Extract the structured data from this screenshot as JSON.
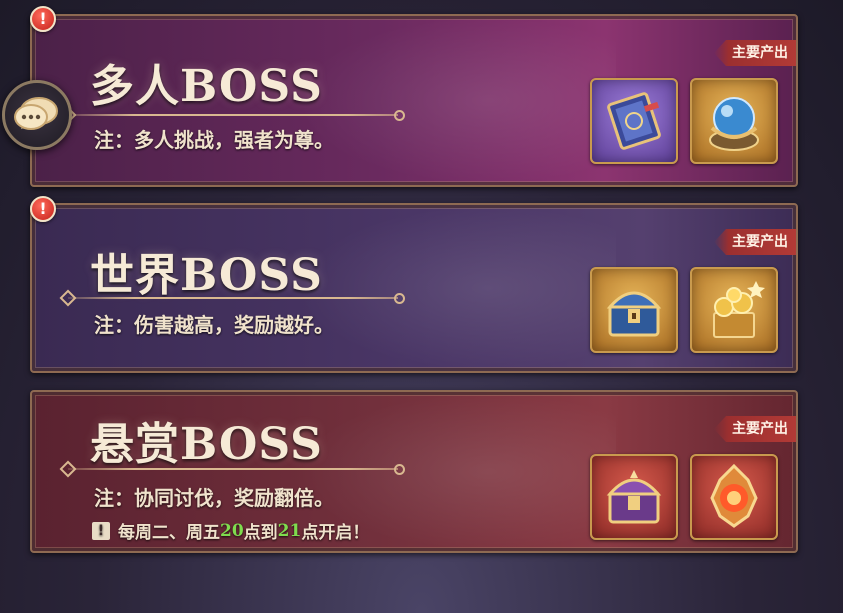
{
  "panels": [
    {
      "title": "多人BOSS",
      "note": "注：多人挑战，强者为尊。",
      "tag": "主要产出",
      "items": [
        "spellbook-icon",
        "crystal-orb-icon"
      ]
    },
    {
      "title": "世界BOSS",
      "note": "注：伤害越高，奖励越好。",
      "tag": "主要产出",
      "items": [
        "treasure-chest-icon",
        "gold-pile-icon"
      ]
    },
    {
      "title": "悬赏BOSS",
      "note": "注：协同讨伐，奖励翻倍。",
      "tag": "主要产出",
      "items": [
        "royal-chest-icon",
        "fire-gem-icon"
      ],
      "schedule": {
        "prefix": "每周二、周五",
        "start": "20",
        "mid": "点到",
        "end": "21",
        "suffix": "点开启！",
        "warn": "!"
      }
    }
  ],
  "badge": "!",
  "colors": {
    "accent_green": "#7fdc4e",
    "badge_red": "#c4201a",
    "frame_gold": "#c49a72"
  }
}
